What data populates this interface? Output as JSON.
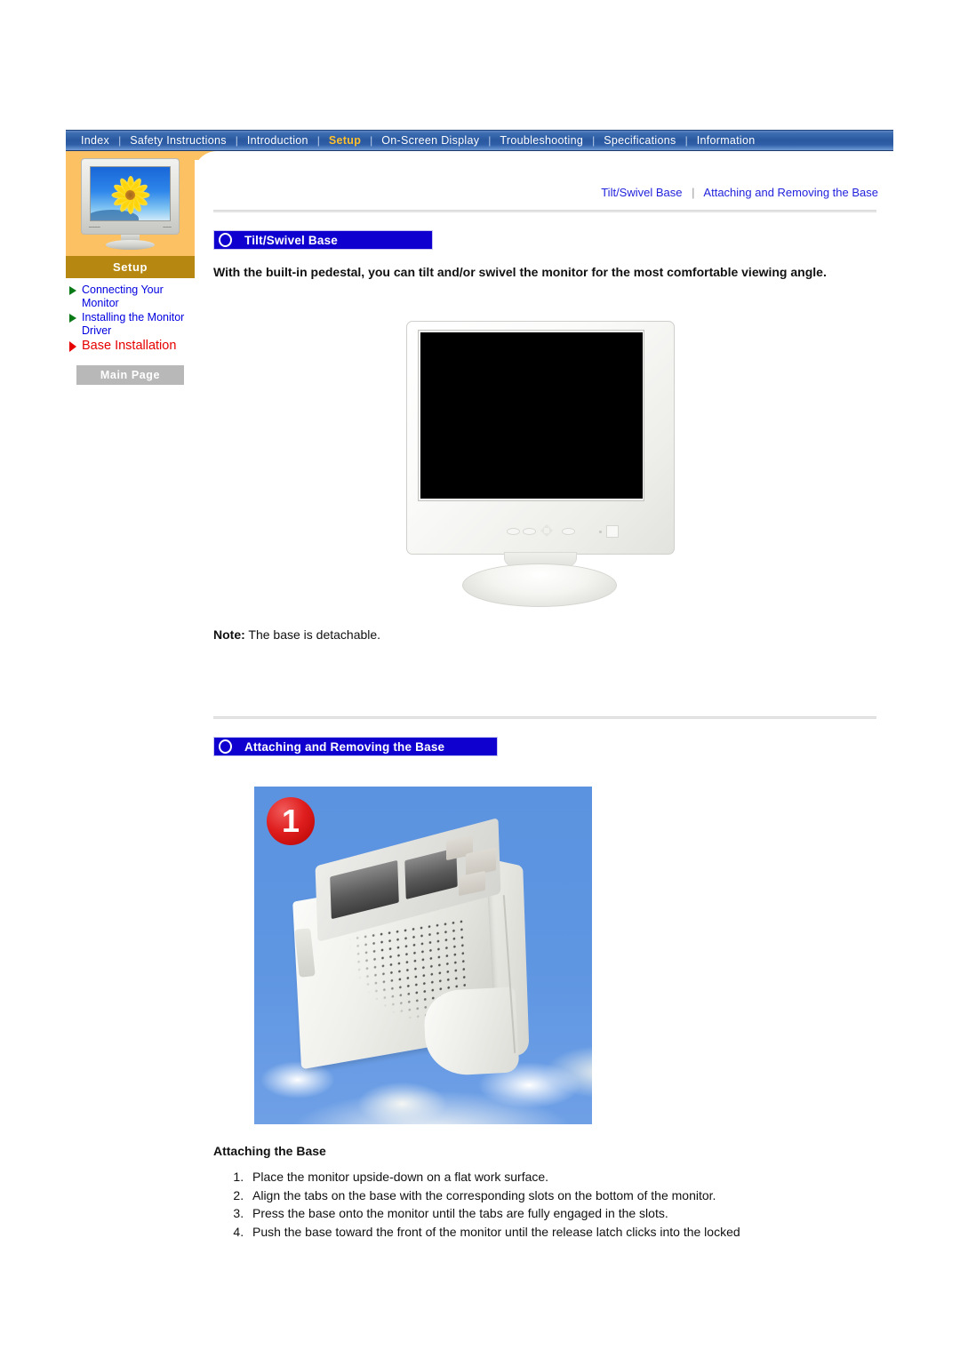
{
  "topnav": {
    "items": [
      {
        "label": "Index",
        "active": false
      },
      {
        "label": "Safety Instructions",
        "active": false
      },
      {
        "label": "Introduction",
        "active": false
      },
      {
        "label": "Setup",
        "active": true
      },
      {
        "label": "On-Screen Display",
        "active": false
      },
      {
        "label": "Troubleshooting",
        "active": false
      },
      {
        "label": "Specifications",
        "active": false
      },
      {
        "label": "Information",
        "active": false
      }
    ],
    "separator": "|"
  },
  "sidebar": {
    "thumbnail_name": "monitor-sunflower-thumbnail",
    "section_title": "Setup",
    "links": [
      {
        "label": "Connecting Your Monitor",
        "current": false,
        "arrow_color": "#0a7a17"
      },
      {
        "label": "Installing the Monitor Driver",
        "current": false,
        "arrow_color": "#0a7a17"
      },
      {
        "label": "Base Installation",
        "current": true,
        "arrow_color": "#e60000"
      }
    ],
    "main_page_button": "Main Page"
  },
  "breadcrumb": {
    "items": [
      "Tilt/Swivel Base",
      "Attaching and Removing the Base"
    ],
    "separator": "|"
  },
  "sections": {
    "tilt_swivel": {
      "heading": "Tilt/Swivel Base",
      "intro": "With the built-in pedestal, you can tilt and/or swivel the monitor for the most comfortable viewing angle.",
      "note_label": "Note:",
      "note_text": "The base is detachable.",
      "figure_name": "monitor-front-view-illustration"
    },
    "attaching_removing": {
      "heading": "Attaching and Removing the Base",
      "photo_badge": "1",
      "photo_name": "monitor-underside-photo",
      "subheading": "Attaching the Base",
      "steps": [
        "Place the monitor upside-down on a flat work surface.",
        "Align the tabs on the base with the corresponding slots on the bottom of the monitor.",
        "Press the base onto the monitor until the tabs are fully engaged in the slots.",
        "Push the base toward the front of the monitor until the release latch clicks into the locked"
      ]
    }
  },
  "colors": {
    "nav_blue": "#2a58a0",
    "nav_active_text": "#ffc12e",
    "sidebar_orange": "#fbc162",
    "sidebar_title_gold": "#b68811",
    "section_header_blue": "#1000d0",
    "link_blue": "#0000e0",
    "current_link_red": "#e60000",
    "badge_red": "#d01010",
    "photo_background_blue": "#5f96e2"
  }
}
